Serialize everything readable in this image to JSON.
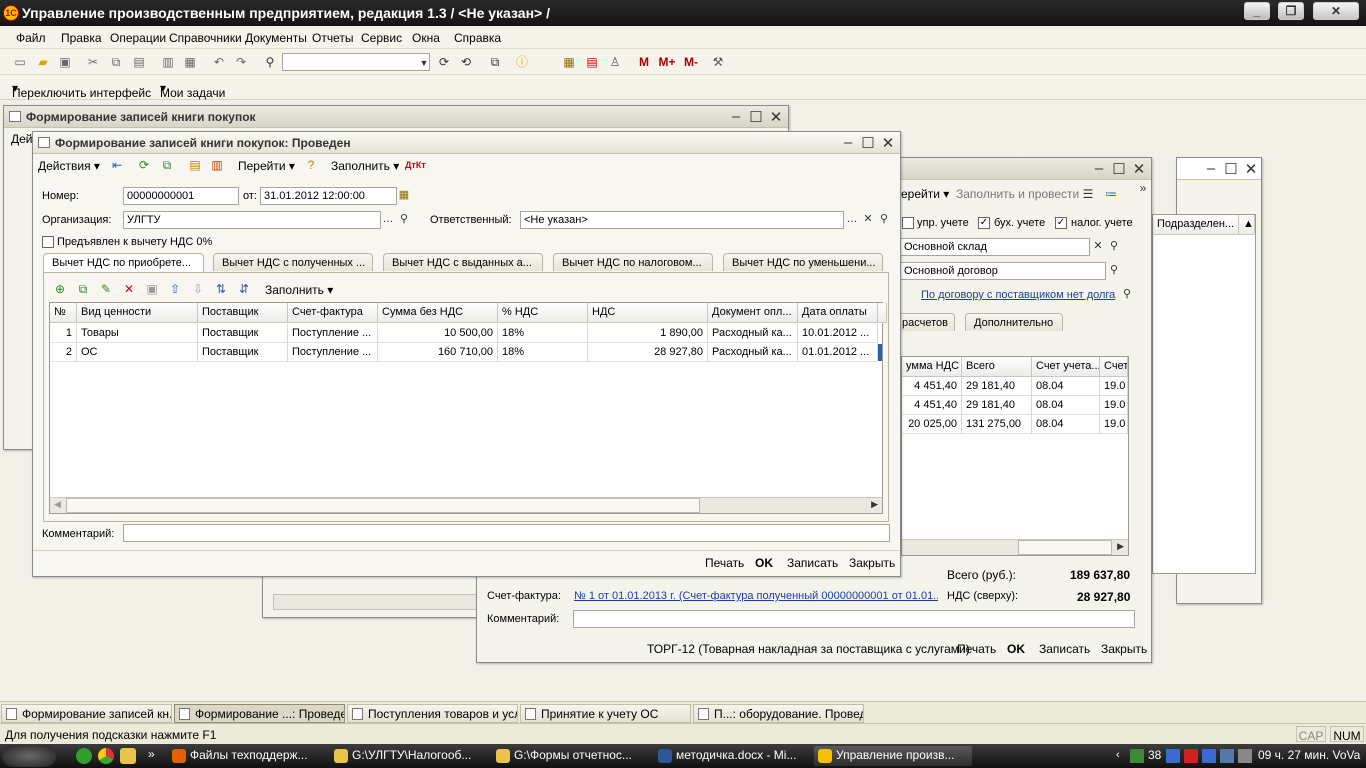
{
  "app": {
    "title": "Управление производственным предприятием, редакция 1.3 / <Не указан> /",
    "logo_text": "1С"
  },
  "menu": [
    "Файл",
    "Правка",
    "Операции",
    "Справочники",
    "Документы",
    "Отчеты",
    "Сервис",
    "Окна",
    "Справка"
  ],
  "toolbar2": {
    "switch_interface": "Переключить интерфейс",
    "my_tasks": "Мои задачи"
  },
  "bg_window": {
    "title": "Формирование записей книги покупок",
    "actions_truncated": "Дей"
  },
  "right_window": {
    "toolbar": {
      "goto": "ерейти",
      "fill_and_post": "Заполнить и провести"
    },
    "checks": [
      {
        "label": "упр. учете",
        "checked": false
      },
      {
        "label": "бух. учете",
        "checked": true
      },
      {
        "label": "налог. учете",
        "checked": true
      }
    ],
    "warehouse": "Основной склад",
    "contract": "Основной договор",
    "contract_note": "По договору с поставщиком нет долга",
    "tabs": [
      "расчетов",
      "Дополнительно"
    ],
    "columns": [
      "умма НДС",
      "Всего",
      "Счет учета...",
      "Счет"
    ],
    "rows": [
      [
        "4 451,40",
        "29 181,40",
        "08.04",
        "19.0"
      ],
      [
        "4 451,40",
        "29 181,40",
        "08.04",
        "19.0"
      ],
      [
        "20 025,00",
        "131 275,00",
        "08.04",
        "19.0"
      ]
    ],
    "total_label": "Всего (руб.):",
    "total_value": "189 637,80",
    "vat_label": "НДС (сверху):",
    "vat_value": "28 927,80",
    "invoice_label": "Счет-фактура:",
    "invoice_link": "№ 1 от 01.01.2013 г. (Счет-фактура полученный 00000000001 от 01.01....",
    "comment_label": "Комментарий:",
    "bottom": {
      "torg": "ТОРГ-12 (Товарная накладная за поставщика с услугами)",
      "print": "Печать",
      "ok": "OK",
      "save": "Записать",
      "close": "Закрыть"
    }
  },
  "far_right": {
    "column": "Подразделен..."
  },
  "main": {
    "title": "Формирование записей книги покупок: Проведен",
    "toolbar": {
      "actions": "Действия",
      "goto": "Перейти",
      "fill": "Заполнить"
    },
    "number_label": "Номер:",
    "number": "00000000001",
    "date_label": "от:",
    "date": "31.01.2012 12:00:00",
    "org_label": "Организация:",
    "org": "УЛГТУ",
    "resp_label": "Ответственный:",
    "resp": "<Не указан>",
    "checkbox0": "Предъявлен к вычету НДС 0%",
    "tabs": [
      "Вычет НДС по приобрете...",
      "Вычет НДС с полученных ...",
      "Вычет НДС с выданных а...",
      "Вычет НДС по налоговом...",
      "Вычет НДС по уменьшени..."
    ],
    "fill": "Заполнить",
    "columns": [
      "№",
      "Вид ценности",
      "Поставщик",
      "Счет-фактура",
      "Сумма без НДС",
      "% НДС",
      "НДС",
      "Документ опл...",
      "Дата оплаты"
    ],
    "rows": [
      [
        "1",
        "Товары",
        "Поставщик",
        "Поступление ...",
        "10 500,00",
        "18%",
        "1 890,00",
        "Расходный ка...",
        "10.01.2012 ..."
      ],
      [
        "2",
        "ОС",
        "Поставщик",
        "Поступление ...",
        "160 710,00",
        "18%",
        "28 927,80",
        "Расходный ка...",
        "01.01.2012 ..."
      ]
    ],
    "comment_label": "Комментарий:",
    "bottom": {
      "print": "Печать",
      "ok": "OK",
      "save": "Записать",
      "close": "Закрыть"
    }
  },
  "taskbar_1c": [
    "Формирование записей кн...",
    "Формирование ...: Проведен",
    "Поступления товаров и услуг",
    "Принятие к учету ОС",
    "П...: оборудование. Проведен"
  ],
  "status": {
    "hint": "Для получения подсказки нажмите F1",
    "cap": "CAP",
    "num": "NUM"
  },
  "win_taskbar": {
    "items": [
      "Файлы техподдерж...",
      "G:\\УЛГТУ\\Налогооб...",
      "G:\\Формы отчетнос...",
      "методичка.docx - Mi...",
      "Управление произв..."
    ],
    "clock": "09 ч. 27 мин. VoVa",
    "tray_count": "38"
  }
}
